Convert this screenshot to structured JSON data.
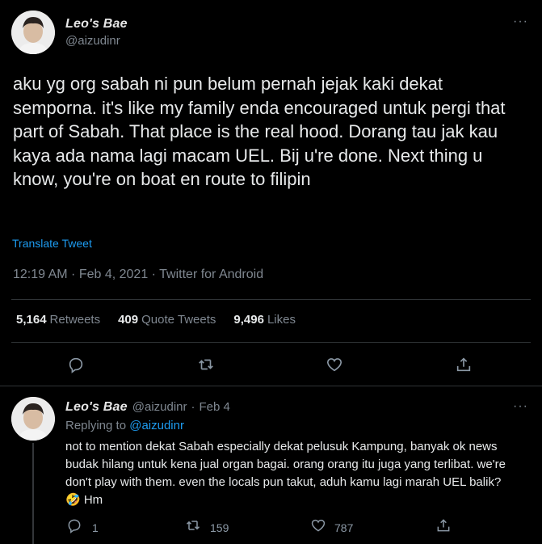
{
  "main_tweet": {
    "author_name": "Leo's Bae",
    "author_handle": "@aizudinr",
    "more": "···",
    "text": "aku yg org sabah ni pun belum pernah jejak kaki dekat semporna. it's like my family enda encouraged untuk pergi that part of Sabah. That place is the real hood. Dorang tau jak kau kaya ada nama lagi macam UEL. Bij u're done. Next thing u know, you're on boat en route to filipin",
    "translate": "Translate Tweet",
    "timestamp": "12:19 AM · Feb 4, 2021 · Twitter for Android",
    "stats": [
      {
        "num": "5,164",
        "label": "Retweets"
      },
      {
        "num": "409",
        "label": "Quote Tweets"
      },
      {
        "num": "9,496",
        "label": "Likes"
      }
    ]
  },
  "reply_tweet": {
    "author_name": "Leo's Bae",
    "author_handle": "@aizudinr",
    "sep": "·",
    "date": "Feb 4",
    "more": "···",
    "replying_prefix": "Replying to",
    "replying_handle": "@aizudinr",
    "text": "not to mention dekat Sabah especially dekat pelusuk Kampung, banyak ok news budak hilang untuk kena jual organ bagai. orang orang itu juga yang terlibat. we're don't play with them. even the locals pun takut, aduh kamu lagi marah UEL balik? 🤣 Hm",
    "reply_count": "1",
    "retweet_count": "159",
    "like_count": "787"
  }
}
